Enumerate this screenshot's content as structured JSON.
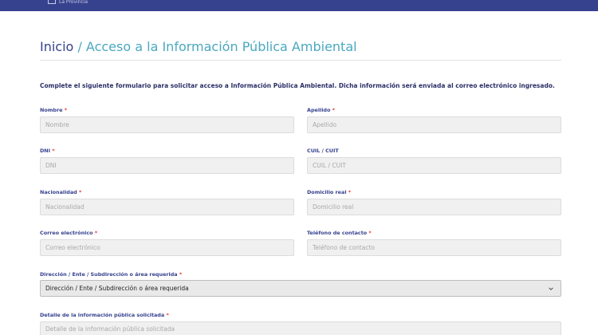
{
  "header": {
    "brand_text": "La Provincia"
  },
  "breadcrumb": {
    "home": "Inicio",
    "separator": "/",
    "current": "Acceso a la Información Pública Ambiental"
  },
  "intro": "Complete el siguiente formulario para solicitar acceso a Información Pública Ambiental. Dicha información será enviada al correo electrónico ingresado.",
  "required_mark": "*",
  "form": {
    "nombre": {
      "label": "Nombre",
      "placeholder": "Nombre"
    },
    "apellido": {
      "label": "Apellido",
      "placeholder": "Apellido"
    },
    "dni": {
      "label": "DNI",
      "placeholder": "DNI"
    },
    "cuil": {
      "label": "CUIL / CUIT",
      "placeholder": "CUIL / CUIT"
    },
    "nacionalidad": {
      "label": "Nacionalidad",
      "placeholder": "Nacionalidad"
    },
    "domicilio": {
      "label": "Domicilio real",
      "placeholder": "Domicilio real"
    },
    "correo": {
      "label": "Correo electrónico",
      "placeholder": "Correo electrónico"
    },
    "telefono": {
      "label": "Teléfono de contacto",
      "placeholder": "Teléfono de contacto"
    },
    "direccion": {
      "label": "Dirección / Ente / Subdirección o área requerida",
      "selected": "Dirección / Ente / Subdirección o área requerida"
    },
    "detalle": {
      "label": "Detalle de la información pública solicitada",
      "placeholder": "Detalle de la información pública solicitada"
    }
  },
  "colors": {
    "header_bg": "#37428f",
    "title_dark": "#37428f",
    "title_accent": "#4aa8bf",
    "label": "#37428f",
    "required": "#e53935"
  },
  "icons": {
    "select": "chevron-down-icon",
    "brand": "brand-logo-icon"
  }
}
